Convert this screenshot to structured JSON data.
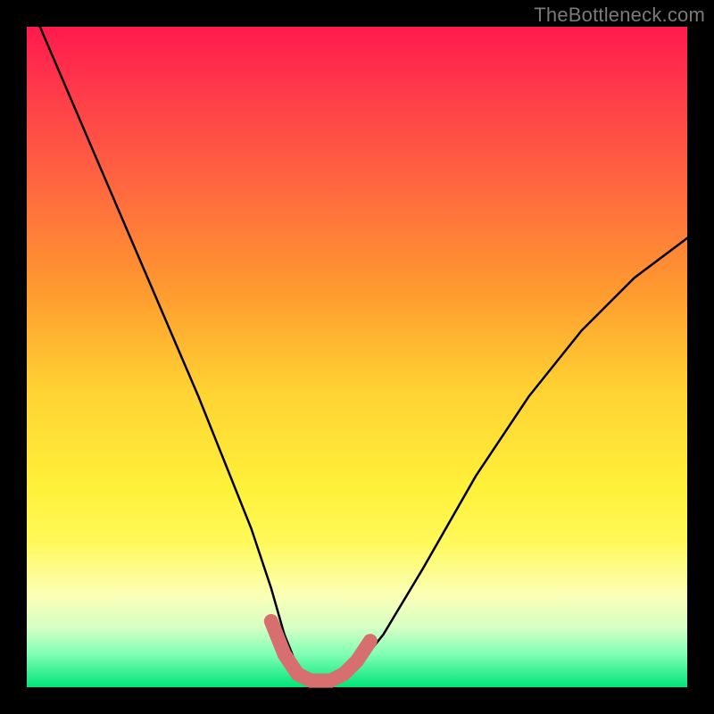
{
  "watermark": "TheBottleneck.com",
  "colors": {
    "curve": "#000000",
    "bottom_accent": "#d86f6f",
    "gradient_top": "#ff1a4d",
    "gradient_mid": "#fff13a",
    "gradient_bottom": "#00e47a",
    "frame": "#000000"
  },
  "chart_data": {
    "type": "line",
    "title": "",
    "xlabel": "",
    "ylabel": "",
    "xlim": [
      0,
      100
    ],
    "ylim": [
      0,
      100
    ],
    "grid": false,
    "legend": false,
    "series": [
      {
        "name": "bottleneck-curve",
        "x": [
          2,
          8,
          14,
          20,
          26,
          30,
          34,
          37,
          39,
          41,
          43,
          46,
          50,
          54,
          60,
          68,
          76,
          84,
          92,
          100
        ],
        "values": [
          100,
          86,
          72,
          58,
          44,
          34,
          24,
          15,
          8,
          3,
          1,
          1,
          3,
          8,
          18,
          32,
          44,
          54,
          62,
          68
        ]
      }
    ],
    "annotations": [
      {
        "name": "bottom-threshold-arc",
        "x": [
          37,
          39,
          41,
          43,
          46,
          48,
          50,
          52
        ],
        "values": [
          10,
          5,
          2,
          1,
          1,
          2,
          4,
          7
        ],
        "style": "accent"
      }
    ]
  }
}
